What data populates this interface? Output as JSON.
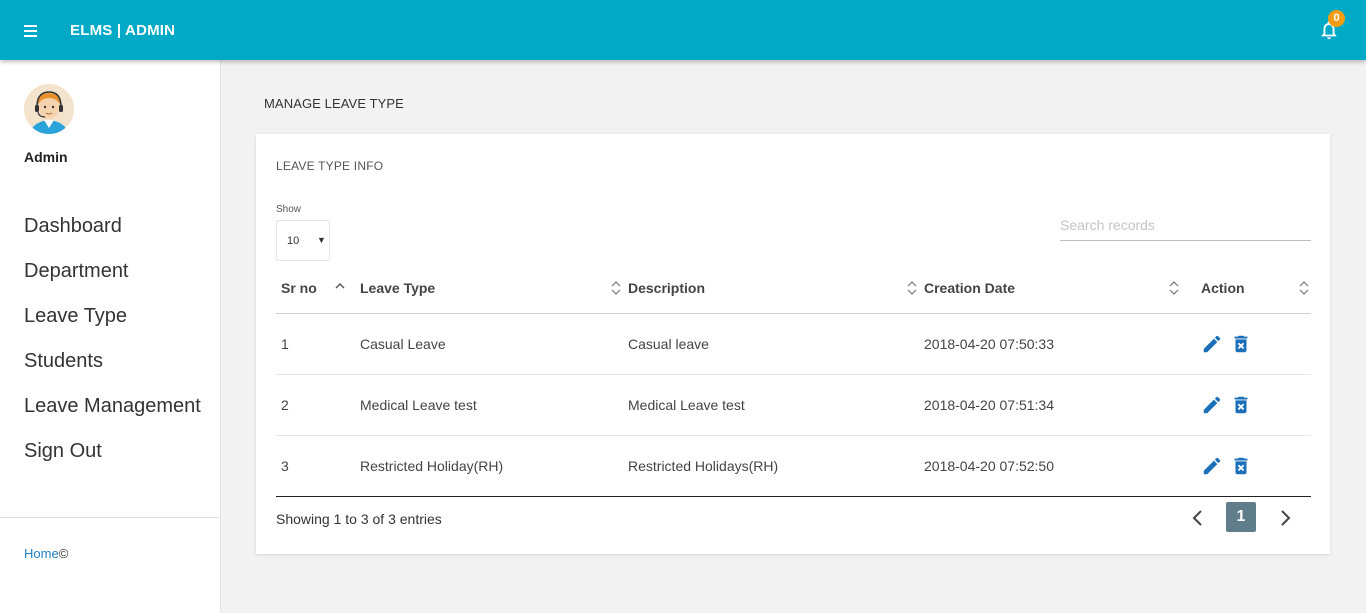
{
  "header": {
    "brand": "ELMS | ADMIN",
    "notification_count": "0"
  },
  "sidebar": {
    "user_name": "Admin",
    "items": [
      {
        "label": "Dashboard"
      },
      {
        "label": "Department"
      },
      {
        "label": "Leave Type"
      },
      {
        "label": "Students"
      },
      {
        "label": "Leave Management"
      },
      {
        "label": "Sign Out"
      }
    ],
    "footer_link": "Home",
    "footer_symbol": "©"
  },
  "main": {
    "page_title": "MANAGE LEAVE TYPE",
    "card_title": "LEAVE TYPE INFO",
    "show_label": "Show",
    "page_length": "10",
    "search_placeholder": "Search records",
    "columns": [
      "Sr no",
      "Leave Type",
      "Description",
      "Creation Date",
      "Action"
    ],
    "rows": [
      {
        "sr": "1",
        "leave_type": "Casual Leave",
        "description": "Casual leave",
        "created": "2018-04-20 07:50:33"
      },
      {
        "sr": "2",
        "leave_type": "Medical Leave test",
        "description": "Medical Leave test",
        "created": "2018-04-20 07:51:34"
      },
      {
        "sr": "3",
        "leave_type": "Restricted Holiday(RH)",
        "description": "Restricted Holidays(RH)",
        "created": "2018-04-20 07:52:50"
      }
    ],
    "info": "Showing 1 to 3 of 3 entries",
    "current_page": "1"
  },
  "colors": {
    "header": "#00aac6",
    "action_icon": "#1a6fb8",
    "badge": "#f39c12",
    "pager_active": "#607d8b"
  }
}
